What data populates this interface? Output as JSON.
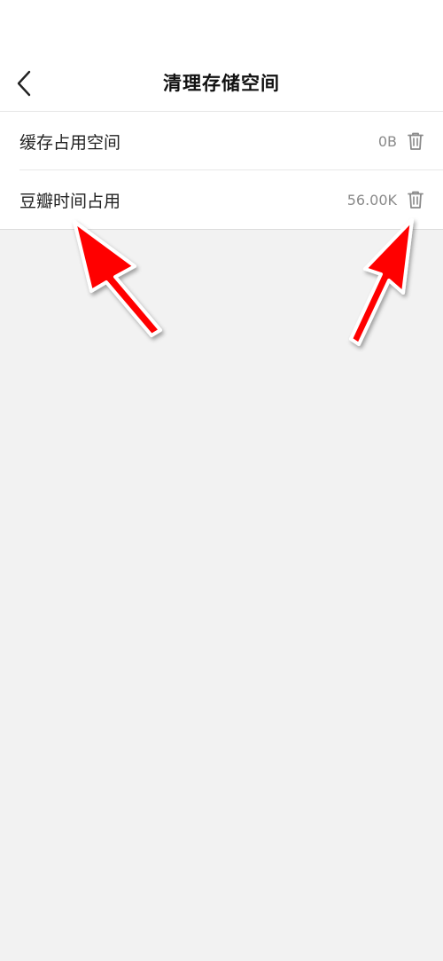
{
  "header": {
    "title": "清理存储空间",
    "back_icon": "chevron-left-icon"
  },
  "storage": {
    "items": [
      {
        "label": "缓存占用空间",
        "value": "0B",
        "icon": "trash-icon"
      },
      {
        "label": "豆瓣时间占用",
        "value": "56.00K",
        "icon": "trash-icon"
      }
    ]
  },
  "annotations": {
    "arrow_color": "#ff0000",
    "arrow_count": 2
  }
}
